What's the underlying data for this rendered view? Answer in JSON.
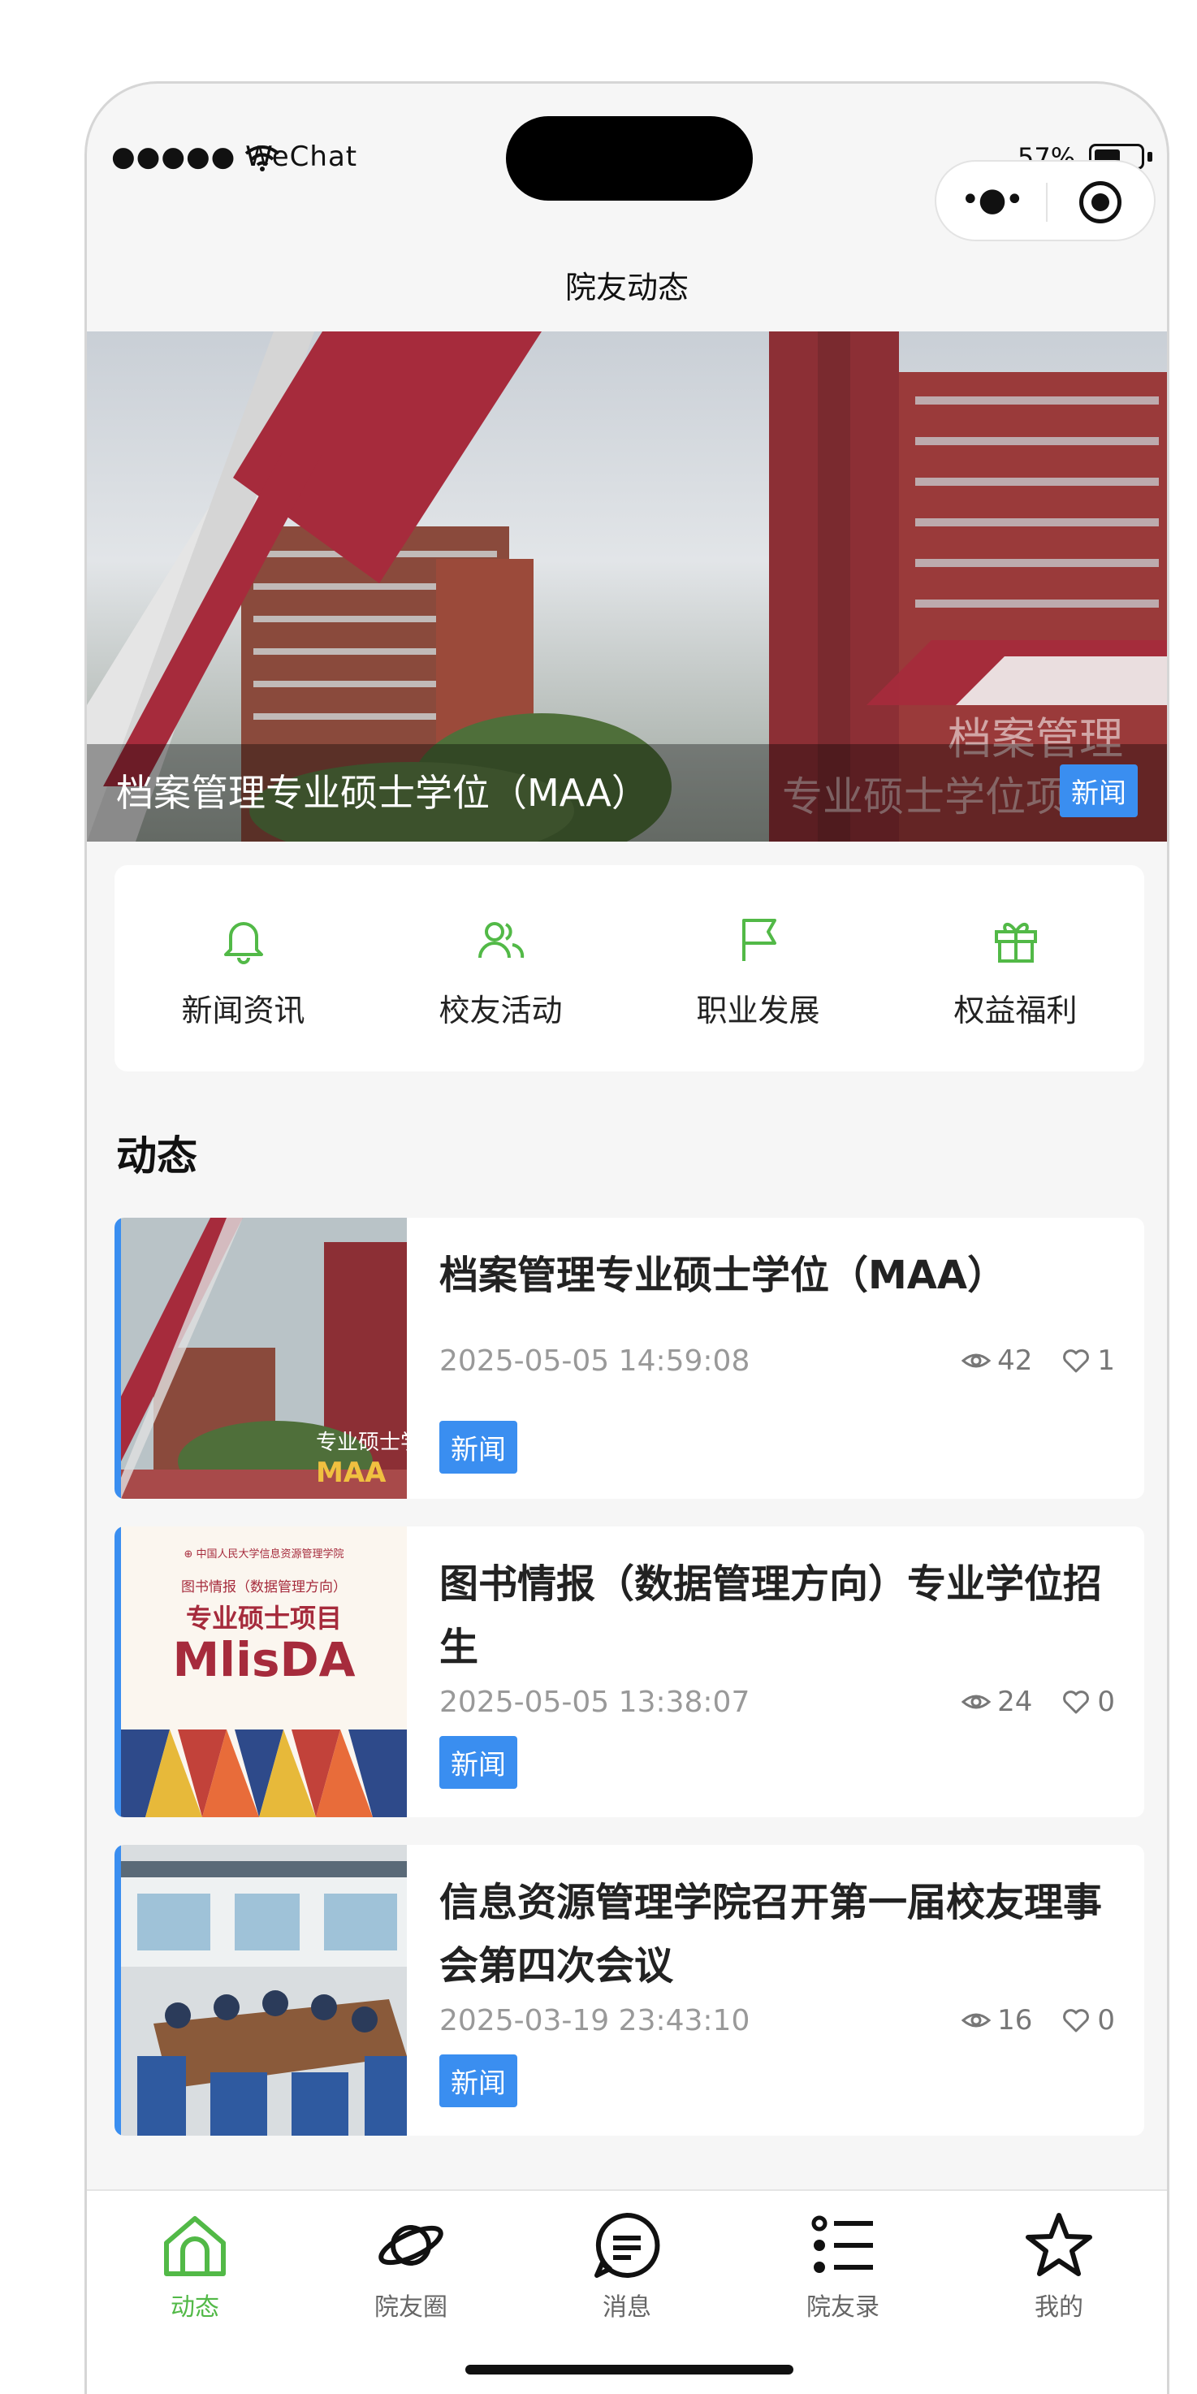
{
  "status_bar": {
    "carrier": "●●●●● WeChat",
    "battery_percent_label": "57%",
    "battery_level": 0.57
  },
  "nav": {
    "title": "院友动态",
    "capsule_more": "•●•"
  },
  "banner": {
    "caption": "档案管理专业硕士学位（MAA）",
    "tag": "新闻",
    "overlay_text_1": "档案管理",
    "overlay_text_2": "专业硕士学位项目"
  },
  "quick_menu": {
    "items": [
      {
        "label": "新闻资讯",
        "icon": "bell-icon"
      },
      {
        "label": "校友活动",
        "icon": "users-icon"
      },
      {
        "label": "职业发展",
        "icon": "flag-icon"
      },
      {
        "label": "权益福利",
        "icon": "gift-icon"
      }
    ]
  },
  "feed": {
    "section_title": "动态",
    "items": [
      {
        "title": "档案管理专业硕士学位（MAA）",
        "date": "2025-05-05 14:59:08",
        "views": "42",
        "likes": "1",
        "tag": "新闻",
        "thumb_text_1": "专业硕士学",
        "thumb_text_2": "MAA"
      },
      {
        "title": "图书情报（数据管理方向）专业学位招生",
        "date": "2025-05-05 13:38:07",
        "views": "24",
        "likes": "0",
        "tag": "新闻",
        "thumb_header": "⊕ 中国人民大学信息资源管理学院",
        "thumb_text_1": "图书情报（数据管理方向）",
        "thumb_text_2": "专业硕士项目",
        "thumb_text_3": "MlisDA"
      },
      {
        "title": "信息资源管理学院召开第一届校友理事会第四次会议",
        "date": "2025-03-19 23:43:10",
        "views": "16",
        "likes": "0",
        "tag": "新闻"
      }
    ]
  },
  "tabbar": {
    "items": [
      {
        "label": "动态",
        "icon": "home-icon",
        "active": true
      },
      {
        "label": "院友圈",
        "icon": "planet-icon",
        "active": false
      },
      {
        "label": "消息",
        "icon": "message-icon",
        "active": false
      },
      {
        "label": "院友录",
        "icon": "list-icon",
        "active": false
      },
      {
        "label": "我的",
        "icon": "star-icon",
        "active": false
      }
    ]
  },
  "colors": {
    "accent_green": "#52b947",
    "tag_blue": "#3a8ef0",
    "brand_red": "#9b2a36"
  }
}
